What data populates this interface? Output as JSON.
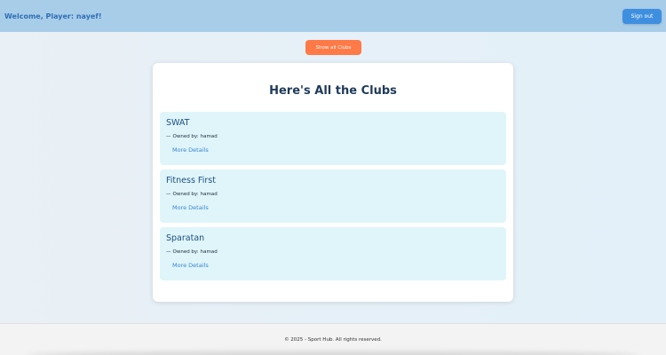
{
  "header": {
    "welcome_text": "Welcome, Player: nayef!",
    "signout_label": "Sign out"
  },
  "actions": {
    "show_all_label": "Show all Clubs"
  },
  "main": {
    "title": "Here's All the Clubs",
    "clubs": [
      {
        "name": "SWAT",
        "owner_prefix": "—",
        "owner_label": "Owned by:",
        "owner": "hamad",
        "link_label": "More Details"
      },
      {
        "name": "Fitness First",
        "owner_prefix": "—",
        "owner_label": "Owned by:",
        "owner": "hamad",
        "link_label": "More Details"
      },
      {
        "name": "Sparatan",
        "owner_prefix": "—",
        "owner_label": "Owned by:",
        "owner": "hamad",
        "link_label": "More Details"
      }
    ]
  },
  "footer": {
    "text": "© 2025 - Sport Hub. All rights reserved."
  },
  "colors": {
    "header_bg": "#a8cde9",
    "accent_blue": "#3f8fe0",
    "accent_orange": "#ff7a47",
    "card_bg": "#dff5f9"
  }
}
